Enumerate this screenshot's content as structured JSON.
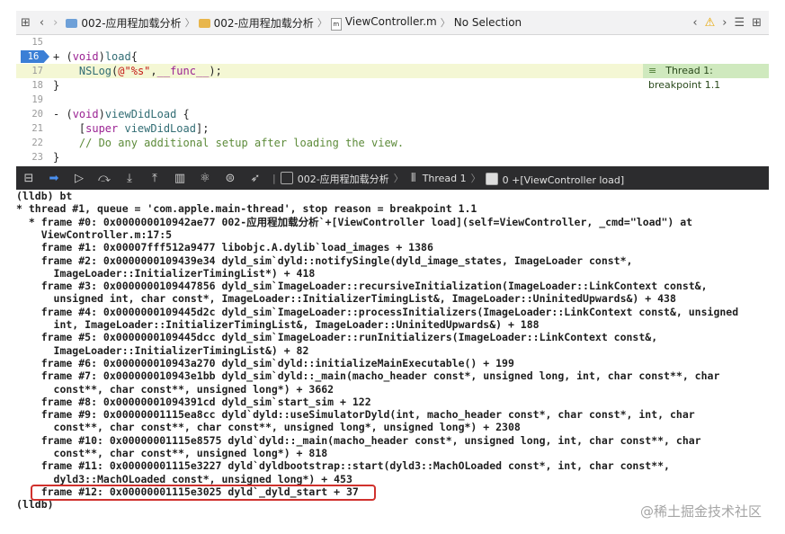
{
  "jumpbar": {
    "crumbs": [
      "002-应用程加载分析",
      "002-应用程加载分析",
      "ViewController.m",
      "No Selection"
    ]
  },
  "editor": {
    "lines": [
      {
        "num": "15",
        "text": ""
      },
      {
        "num": "16",
        "text": "+ (void)load{"
      },
      {
        "num": "17",
        "text": "    NSLog(@\"%s\",__func__);"
      },
      {
        "num": "18",
        "text": "}"
      },
      {
        "num": "19",
        "text": ""
      },
      {
        "num": "20",
        "text": "- (void)viewDidLoad {"
      },
      {
        "num": "21",
        "text": "    [super viewDidLoad];"
      },
      {
        "num": "22",
        "text": "    // Do any additional setup after loading the view."
      },
      {
        "num": "23",
        "text": "}"
      }
    ],
    "breakpoint_label": "Thread 1: breakpoint 1.1"
  },
  "debugbar": {
    "target": "002-应用程加载分析",
    "thread": "Thread 1",
    "frame": "0 +[ViewController load]"
  },
  "console": {
    "lines": [
      "(lldb) bt",
      "* thread #1, queue = 'com.apple.main-thread', stop reason = breakpoint 1.1",
      "  * frame #0: 0x000000010942ae77 002-应用程加载分析`+[ViewController load](self=ViewController, _cmd=\"load\") at",
      "    ViewController.m:17:5",
      "    frame #1: 0x00007fff512a9477 libobjc.A.dylib`load_images + 1386",
      "    frame #2: 0x0000000109439e34 dyld_sim`dyld::notifySingle(dyld_image_states, ImageLoader const*,",
      "      ImageLoader::InitializerTimingList*) + 418",
      "    frame #3: 0x0000000109447856 dyld_sim`ImageLoader::recursiveInitialization(ImageLoader::LinkContext const&,",
      "      unsigned int, char const*, ImageLoader::InitializerTimingList&, ImageLoader::UninitedUpwards&) + 438",
      "    frame #4: 0x0000000109445d2c dyld_sim`ImageLoader::processInitializers(ImageLoader::LinkContext const&, unsigned",
      "      int, ImageLoader::InitializerTimingList&, ImageLoader::UninitedUpwards&) + 188",
      "    frame #5: 0x0000000109445dcc dyld_sim`ImageLoader::runInitializers(ImageLoader::LinkContext const&,",
      "      ImageLoader::InitializerTimingList&) + 82",
      "    frame #6: 0x000000010943a270 dyld_sim`dyld::initializeMainExecutable() + 199",
      "    frame #7: 0x000000010943e1bb dyld_sim`dyld::_main(macho_header const*, unsigned long, int, char const**, char",
      "      const**, char const**, unsigned long*) + 3662",
      "    frame #8: 0x00000001094391cd dyld_sim`start_sim + 122",
      "    frame #9: 0x00000001115ea8cc dyld`dyld::useSimulatorDyld(int, macho_header const*, char const*, int, char",
      "      const**, char const**, char const**, unsigned long*, unsigned long*) + 2308",
      "    frame #10: 0x00000001115e8575 dyld`dyld::_main(macho_header const*, unsigned long, int, char const**, char",
      "      const**, char const**, unsigned long*) + 818",
      "    frame #11: 0x00000001115e3227 dyld`dyldbootstrap::start(dyld3::MachOLoaded const*, int, char const**,",
      "      dyld3::MachOLoaded const*, unsigned long*) + 453",
      "    frame #12: 0x00000001115e3025 dyld`_dyld_start + 37",
      "(lldb)"
    ],
    "watermark": "@稀土掘金技术社区"
  },
  "colors": {
    "highlight_box": "#d0312d",
    "breakpoint": "#3b7fd6",
    "debug_bar": "#2c2c2e"
  }
}
